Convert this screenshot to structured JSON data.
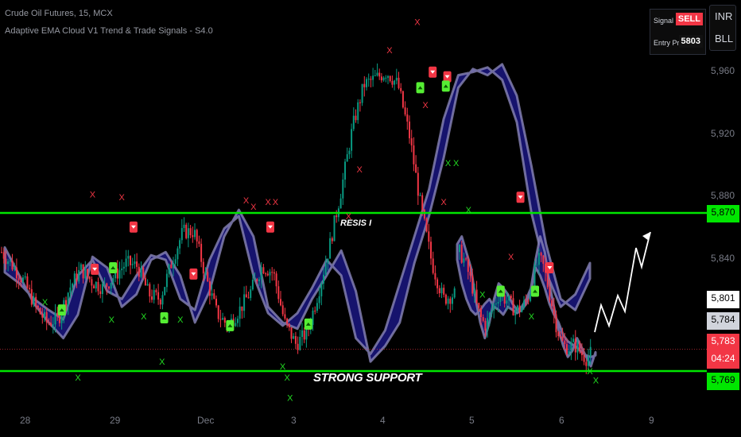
{
  "header": {
    "symbol_line": "Crude Oil Futures, 15, MCX",
    "indicator_line": "Adaptive EMA Cloud V1 Trend & Trade Signals - S4.0"
  },
  "signal_panel": {
    "signal_label": "Signal",
    "signal_value": "SELL",
    "entry_label": "Entry Price",
    "entry_value": "5803",
    "signal_color": "#f23645"
  },
  "currency": {
    "line1": "INR",
    "line2": "BLL"
  },
  "chart_data": {
    "type": "line",
    "y_ticks": [
      "5,960",
      "5,920",
      "5,880",
      "5,840"
    ],
    "x_ticks": [
      "28",
      "29",
      "Dec",
      "3",
      "4",
      "5",
      "6",
      "9"
    ],
    "ylim": [
      5755,
      5985
    ],
    "x": [
      0,
      2,
      4,
      6,
      8,
      10,
      12,
      14,
      16,
      18,
      20,
      22,
      24,
      26,
      28,
      30,
      32,
      34,
      36,
      38,
      40,
      42,
      44,
      46,
      48,
      50,
      52,
      54,
      56,
      58,
      60,
      62,
      64,
      66,
      68,
      70,
      72,
      74,
      76,
      78,
      80
    ],
    "series": [
      {
        "values": [
          5848,
          5830,
          5812,
          5800,
          5790,
          5805,
          5842,
          5835,
          5810,
          5818,
          5840,
          5845,
          5830,
          5800,
          5820,
          5855,
          5872,
          5855,
          5810,
          5800,
          5796,
          5815,
          5830,
          5846,
          5820,
          5775,
          5785,
          5800,
          5838,
          5868,
          5905,
          5950,
          5962,
          5958,
          5965,
          5945,
          5900,
          5850,
          5815,
          5808,
          5828
        ]
      },
      {
        "values": [
          5845,
          5836,
          5826,
          5810,
          5800,
          5802,
          5822,
          5834,
          5826,
          5822,
          5830,
          5838,
          5836,
          5818,
          5815,
          5838,
          5858,
          5858,
          5830,
          5806,
          5798,
          5808,
          5820,
          5836,
          5832,
          5800,
          5786,
          5794,
          5820,
          5850,
          5885,
          5925,
          5952,
          5956,
          5960,
          5952,
          5920,
          5875,
          5838,
          5815,
          5818
        ]
      },
      {
        "values": [
          5832,
          5825,
          5815,
          5808,
          5802,
          5830,
          5840,
          5820,
          5815,
          5830,
          5843,
          5840,
          5815,
          5808,
          5840,
          5860,
          5868,
          5830,
          5806,
          5798,
          5806,
          5822,
          5840,
          5830,
          5790,
          5780,
          5795,
          5825,
          5855,
          5885,
          5930,
          5958,
          5960,
          5963,
          5955,
          5928,
          5870,
          5832,
          5810,
          5818,
          5838
        ]
      },
      {
        "values": [
          5850,
          5855,
          5845,
          5835,
          5815,
          5800,
          5790,
          5800,
          5815,
          5825,
          5822,
          5818,
          5812,
          5808,
          5810,
          5815,
          5822,
          5840,
          5855,
          5845,
          5825,
          5810,
          5795,
          5785,
          5778,
          5782,
          5790,
          5784,
          5778,
          5772,
          5781
        ]
      },
      {
        "values": [
          5845,
          5840,
          5832,
          5822,
          5810,
          5802,
          5798,
          5805,
          5812,
          5818,
          5816,
          5814,
          5810,
          5808,
          5809,
          5812,
          5818,
          5830,
          5840,
          5838,
          5826,
          5814,
          5800,
          5790,
          5785,
          5784,
          5786,
          5784,
          5780,
          5777,
          5780
        ]
      },
      {
        "values": [
          5840,
          5825,
          5815,
          5808,
          5805,
          5808,
          5812,
          5815,
          5810,
          5808,
          5805,
          5810,
          5808,
          5806,
          5808,
          5812,
          5820,
          5835,
          5830,
          5822,
          5812,
          5805,
          5800,
          5792,
          5788,
          5786,
          5784,
          5781,
          5779,
          5778,
          5779
        ]
      }
    ],
    "levels": [
      {
        "value": 5870,
        "label": "5,870"
      },
      {
        "value": 5769,
        "label": "5,769"
      }
    ],
    "price_tags": [
      {
        "label": "5,801",
        "color": "#ffffff"
      },
      {
        "label": "5,784",
        "color": "#d1d4dc"
      },
      {
        "label": "5,783",
        "color": "#f23645"
      },
      {
        "label": "04:24",
        "color": "#f23645"
      }
    ],
    "annotations": [
      "STRONG SUPPORT",
      "RESIS I"
    ],
    "x_marks": [
      "X"
    ],
    "grid": false,
    "colors": {
      "cloud": "#1a1680",
      "cloud_edge": "#8a86b8",
      "level": "#00e600",
      "up": "#089981",
      "down": "#f23645"
    }
  }
}
